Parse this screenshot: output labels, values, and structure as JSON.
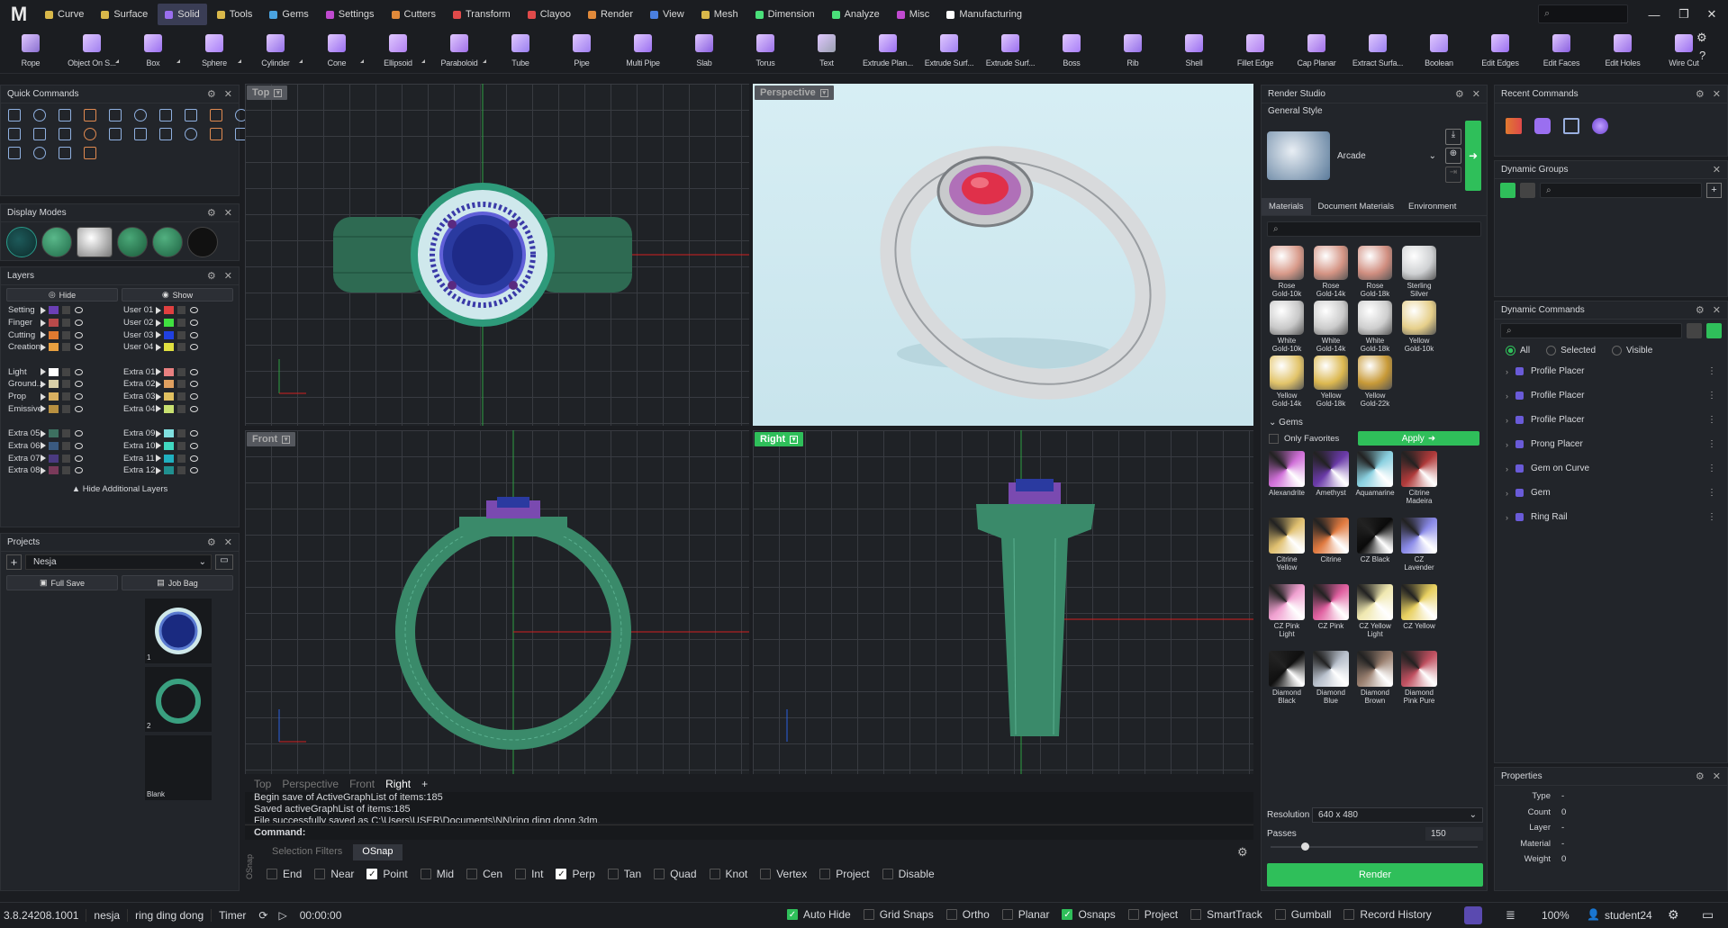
{
  "app": {
    "logo": "M"
  },
  "menu": [
    {
      "label": "Curve",
      "color": "#d9b84a"
    },
    {
      "label": "Surface",
      "color": "#d9b84a"
    },
    {
      "label": "Solid",
      "color": "#9a6ff0",
      "active": true
    },
    {
      "label": "Tools",
      "color": "#d9b84a"
    },
    {
      "label": "Gems",
      "color": "#4aa3e0"
    },
    {
      "label": "Settings",
      "color": "#c04ad0"
    },
    {
      "label": "Cutters",
      "color": "#e0893a"
    },
    {
      "label": "Transform",
      "color": "#e04a4a"
    },
    {
      "label": "Clayoo",
      "color": "#e04a4a"
    },
    {
      "label": "Render",
      "color": "#e0893a"
    },
    {
      "label": "View",
      "color": "#4a7fe0"
    },
    {
      "label": "Mesh",
      "color": "#d9b84a"
    },
    {
      "label": "Dimension",
      "color": "#4ae07a"
    },
    {
      "label": "Analyze",
      "color": "#4ae07a"
    },
    {
      "label": "Misc",
      "color": "#c04ad0"
    },
    {
      "label": "Manufacturing",
      "color": "#ffffff"
    }
  ],
  "top_search_placeholder": "⌕",
  "tools": [
    "Rope",
    "Object On S...",
    "Box",
    "Sphere",
    "Cylinder",
    "Cone",
    "Ellipsoid",
    "Paraboloid",
    "Tube",
    "Pipe",
    "Multi Pipe",
    "Slab",
    "Torus",
    "Text",
    "Extrude Plan...",
    "Extrude Surf...",
    "Extrude Surf...",
    "Boss",
    "Rib",
    "Shell",
    "Fillet Edge",
    "Cap Planar",
    "Extract Surfa...",
    "Boolean",
    "Edit Edges",
    "Edit Faces",
    "Edit Holes",
    "Wire Cut"
  ],
  "quick_commands": {
    "title": "Quick Commands"
  },
  "display_modes": {
    "title": "Display Modes"
  },
  "layers": {
    "title": "Layers",
    "hide_label": "Hide",
    "show_label": "Show",
    "left": [
      {
        "name": "Setting",
        "color": "#6b3fb5"
      },
      {
        "name": "Finger",
        "color": "#b84a4a"
      },
      {
        "name": "Cutting",
        "color": "#e07a30"
      },
      {
        "name": "Creation",
        "color": "#e8a040"
      },
      {
        "name": "",
        "color": ""
      },
      {
        "name": "Light",
        "color": "#ffffff"
      },
      {
        "name": "Ground...",
        "color": "#d8cfa8"
      },
      {
        "name": "Prop",
        "color": "#d8b060"
      },
      {
        "name": "Emissive",
        "color": "#b89040"
      },
      {
        "name": "",
        "color": ""
      },
      {
        "name": "Extra 05",
        "color": "#3d7060"
      },
      {
        "name": "Extra 06",
        "color": "#3a5a80"
      },
      {
        "name": "Extra 07",
        "color": "#4a3a80"
      },
      {
        "name": "Extra 08",
        "color": "#7a3a5a"
      }
    ],
    "right": [
      {
        "name": "User 01",
        "color": "#e04040"
      },
      {
        "name": "User 02",
        "color": "#40e040"
      },
      {
        "name": "User 03",
        "color": "#2040e0"
      },
      {
        "name": "User 04",
        "color": "#e0e040"
      },
      {
        "name": "",
        "color": ""
      },
      {
        "name": "Extra 01",
        "color": "#e88080"
      },
      {
        "name": "Extra 02",
        "color": "#e0a060"
      },
      {
        "name": "Extra 03",
        "color": "#e0c060"
      },
      {
        "name": "Extra 04",
        "color": "#c8e070"
      },
      {
        "name": "",
        "color": ""
      },
      {
        "name": "Extra 09",
        "color": "#80e0e0"
      },
      {
        "name": "Extra 10",
        "color": "#40d8c0"
      },
      {
        "name": "Extra 11",
        "color": "#20b0c0"
      },
      {
        "name": "Extra 12",
        "color": "#209090"
      }
    ],
    "hide_additional": "Hide Additional Layers"
  },
  "projects": {
    "title": "Projects",
    "current": "Nesja",
    "full_save": "Full Save",
    "job_bag": "Job Bag",
    "thumbs": [
      {
        "label": "1"
      },
      {
        "label": "2"
      },
      {
        "label": "Blank"
      }
    ]
  },
  "viewports": {
    "top": "Top",
    "perspective": "Perspective",
    "front": "Front",
    "right": "Right"
  },
  "view_tabs": [
    "Top",
    "Perspective",
    "Front",
    "Right"
  ],
  "view_tab_active": "Right",
  "log": [
    "Begin save of ActiveGraphList of items:185",
    "Saved activeGraphList of items:185",
    "File successfully saved as C:\\Users\\USER\\Documents\\NN\\ring ding dong.3dm."
  ],
  "command_label": "Command:",
  "osnap": {
    "vertical_label": "OSnap",
    "tabs": [
      "Selection Filters",
      "OSnap"
    ],
    "items": [
      {
        "label": "End",
        "on": false
      },
      {
        "label": "Near",
        "on": false
      },
      {
        "label": "Point",
        "on": true
      },
      {
        "label": "Mid",
        "on": false
      },
      {
        "label": "Cen",
        "on": false
      },
      {
        "label": "Int",
        "on": false
      },
      {
        "label": "Perp",
        "on": true
      },
      {
        "label": "Tan",
        "on": false
      },
      {
        "label": "Quad",
        "on": false
      },
      {
        "label": "Knot",
        "on": false
      },
      {
        "label": "Vertex",
        "on": false
      },
      {
        "label": "Project",
        "on": false
      },
      {
        "label": "Disable",
        "on": false
      }
    ]
  },
  "render_studio": {
    "title": "Render Studio",
    "general_style": "General Style",
    "style_name": "Arcade",
    "tabs": [
      "Materials",
      "Document Materials",
      "Environment"
    ],
    "materials": [
      {
        "name": "Rose Gold-10k",
        "color": "#d89a8a"
      },
      {
        "name": "Rose Gold-14k",
        "color": "#d49484"
      },
      {
        "name": "Rose Gold-18k",
        "color": "#d08e80"
      },
      {
        "name": "Sterling Silver",
        "color": "#cfd1d3"
      },
      {
        "name": "White Gold-10k",
        "color": "#c8c8c8"
      },
      {
        "name": "White Gold-14k",
        "color": "#cbcbcb"
      },
      {
        "name": "White Gold-18k",
        "color": "#cecece"
      },
      {
        "name": "Yellow Gold-10k",
        "color": "#e6cf8a"
      },
      {
        "name": "Yellow Gold-14k",
        "color": "#e2c46a"
      },
      {
        "name": "Yellow Gold-18k",
        "color": "#dcb850"
      },
      {
        "name": "Yellow Gold-22k",
        "color": "#c89a38"
      }
    ],
    "gems_title": "Gems",
    "only_favorites": "Only Favorites",
    "apply": "Apply",
    "gems": [
      {
        "name": "Alexandrite",
        "color": "#d070d8"
      },
      {
        "name": "Amethyst",
        "color": "#6a3aa8"
      },
      {
        "name": "Aquamarine",
        "color": "#8ad0e0"
      },
      {
        "name": "Citrine Madeira",
        "color": "#b03a3a"
      },
      {
        "name": "Citrine Yellow",
        "color": "#e0c070"
      },
      {
        "name": "Citrine",
        "color": "#e07a40"
      },
      {
        "name": "CZ Black",
        "color": "#0a0a0a"
      },
      {
        "name": "CZ Lavender",
        "color": "#8a8ae8"
      },
      {
        "name": "CZ Pink Light",
        "color": "#f0a0d0"
      },
      {
        "name": "CZ Pink",
        "color": "#e060a0"
      },
      {
        "name": "CZ Yellow Light",
        "color": "#f0e8b0"
      },
      {
        "name": "CZ Yellow",
        "color": "#e8d060"
      },
      {
        "name": "Diamond Black",
        "color": "#101010"
      },
      {
        "name": "Diamond Blue",
        "color": "#b8c0cc"
      },
      {
        "name": "Diamond Brown",
        "color": "#9a8070"
      },
      {
        "name": "Diamond Pink Pure",
        "color": "#c05060"
      }
    ],
    "resolution_label": "Resolution",
    "resolution": "640 x 480",
    "passes_label": "Passes",
    "passes": "150",
    "render_button": "Render"
  },
  "recent_commands": {
    "title": "Recent Commands"
  },
  "dynamic_groups": {
    "title": "Dynamic Groups"
  },
  "dynamic_commands": {
    "title": "Dynamic Commands",
    "filters": [
      "All",
      "Selected",
      "Visible"
    ],
    "items": [
      "Profile Placer",
      "Profile Placer",
      "Profile Placer",
      "Prong Placer",
      "Gem on Curve",
      "Gem",
      "Ring Rail"
    ]
  },
  "properties": {
    "title": "Properties",
    "rows": [
      {
        "k": "Type",
        "v": "-"
      },
      {
        "k": "Count",
        "v": "0"
      },
      {
        "k": "Layer",
        "v": "-"
      },
      {
        "k": "Material",
        "v": "-"
      },
      {
        "k": "Weight",
        "v": "0"
      }
    ]
  },
  "status": {
    "version": "3.8.24208.1001",
    "user_dir": "nesja",
    "file": "ring ding dong",
    "timer_label": "Timer",
    "time": "00:00:00",
    "toggles": [
      {
        "label": "Auto Hide",
        "on": true
      },
      {
        "label": "Grid Snaps",
        "on": false
      },
      {
        "label": "Ortho",
        "on": false
      },
      {
        "label": "Planar",
        "on": false
      },
      {
        "label": "Osnaps",
        "on": true
      },
      {
        "label": "Project",
        "on": false
      },
      {
        "label": "SmartTrack",
        "on": false
      },
      {
        "label": "Gumball",
        "on": false
      },
      {
        "label": "Record History",
        "on": false
      }
    ],
    "zoom": "100%",
    "account": "student24"
  }
}
